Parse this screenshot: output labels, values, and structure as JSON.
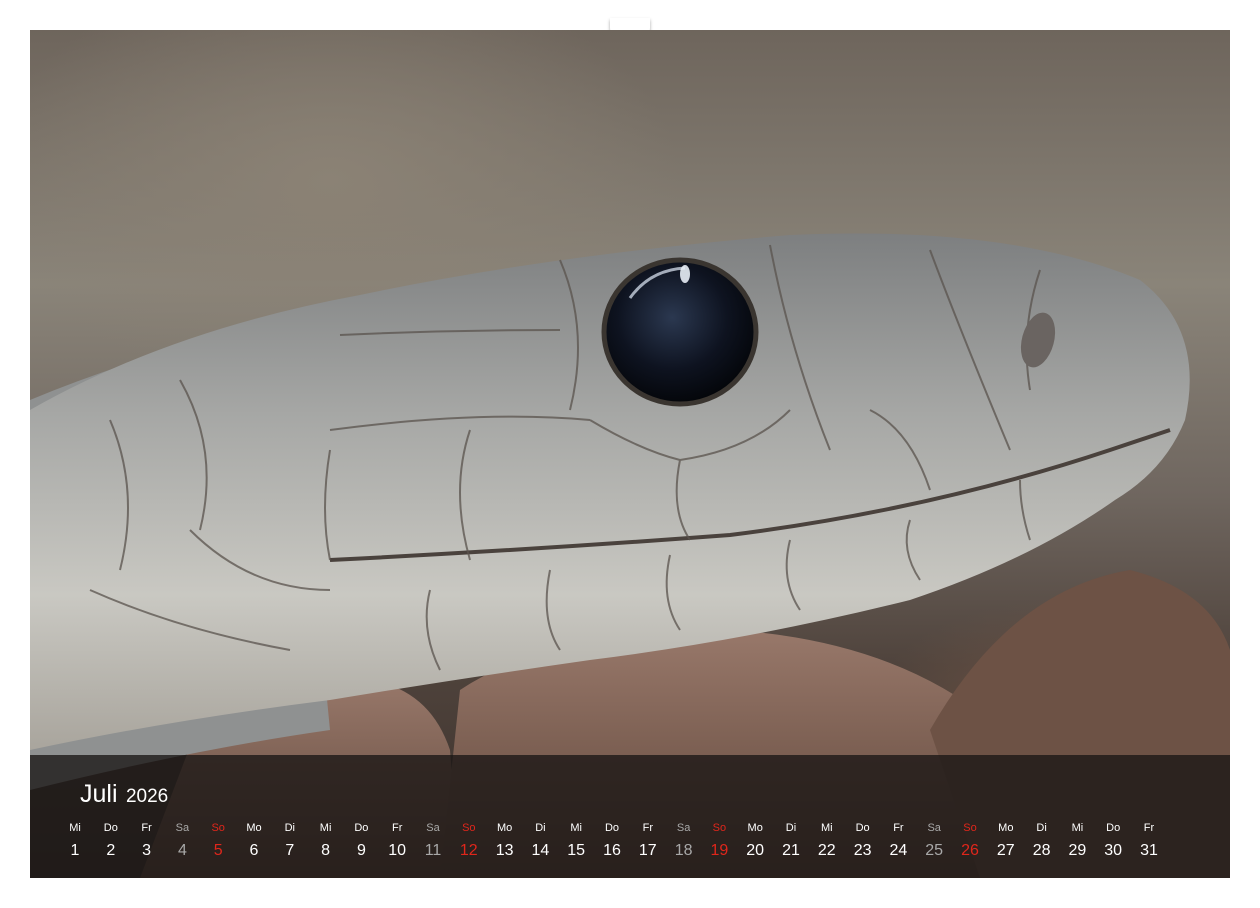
{
  "calendar": {
    "month": "Juli",
    "year": "2026",
    "colors": {
      "weekday": "#ffffff",
      "saturday": "#a8a8a8",
      "sunday": "#e0261b"
    },
    "days": [
      {
        "dow": "Mi",
        "num": "1",
        "kind": "weekday"
      },
      {
        "dow": "Do",
        "num": "2",
        "kind": "weekday"
      },
      {
        "dow": "Fr",
        "num": "3",
        "kind": "weekday"
      },
      {
        "dow": "Sa",
        "num": "4",
        "kind": "saturday"
      },
      {
        "dow": "So",
        "num": "5",
        "kind": "sunday"
      },
      {
        "dow": "Mo",
        "num": "6",
        "kind": "weekday"
      },
      {
        "dow": "Di",
        "num": "7",
        "kind": "weekday"
      },
      {
        "dow": "Mi",
        "num": "8",
        "kind": "weekday"
      },
      {
        "dow": "Do",
        "num": "9",
        "kind": "weekday"
      },
      {
        "dow": "Fr",
        "num": "10",
        "kind": "weekday"
      },
      {
        "dow": "Sa",
        "num": "11",
        "kind": "saturday"
      },
      {
        "dow": "So",
        "num": "12",
        "kind": "sunday"
      },
      {
        "dow": "Mo",
        "num": "13",
        "kind": "weekday"
      },
      {
        "dow": "Di",
        "num": "14",
        "kind": "weekday"
      },
      {
        "dow": "Mi",
        "num": "15",
        "kind": "weekday"
      },
      {
        "dow": "Do",
        "num": "16",
        "kind": "weekday"
      },
      {
        "dow": "Fr",
        "num": "17",
        "kind": "weekday"
      },
      {
        "dow": "Sa",
        "num": "18",
        "kind": "saturday"
      },
      {
        "dow": "So",
        "num": "19",
        "kind": "sunday"
      },
      {
        "dow": "Mo",
        "num": "20",
        "kind": "weekday"
      },
      {
        "dow": "Di",
        "num": "21",
        "kind": "weekday"
      },
      {
        "dow": "Mi",
        "num": "22",
        "kind": "weekday"
      },
      {
        "dow": "Do",
        "num": "23",
        "kind": "weekday"
      },
      {
        "dow": "Fr",
        "num": "24",
        "kind": "weekday"
      },
      {
        "dow": "Sa",
        "num": "25",
        "kind": "saturday"
      },
      {
        "dow": "So",
        "num": "26",
        "kind": "sunday"
      },
      {
        "dow": "Mo",
        "num": "27",
        "kind": "weekday"
      },
      {
        "dow": "Di",
        "num": "28",
        "kind": "weekday"
      },
      {
        "dow": "Mi",
        "num": "29",
        "kind": "weekday"
      },
      {
        "dow": "Do",
        "num": "30",
        "kind": "weekday"
      },
      {
        "dow": "Fr",
        "num": "31",
        "kind": "weekday"
      }
    ]
  }
}
